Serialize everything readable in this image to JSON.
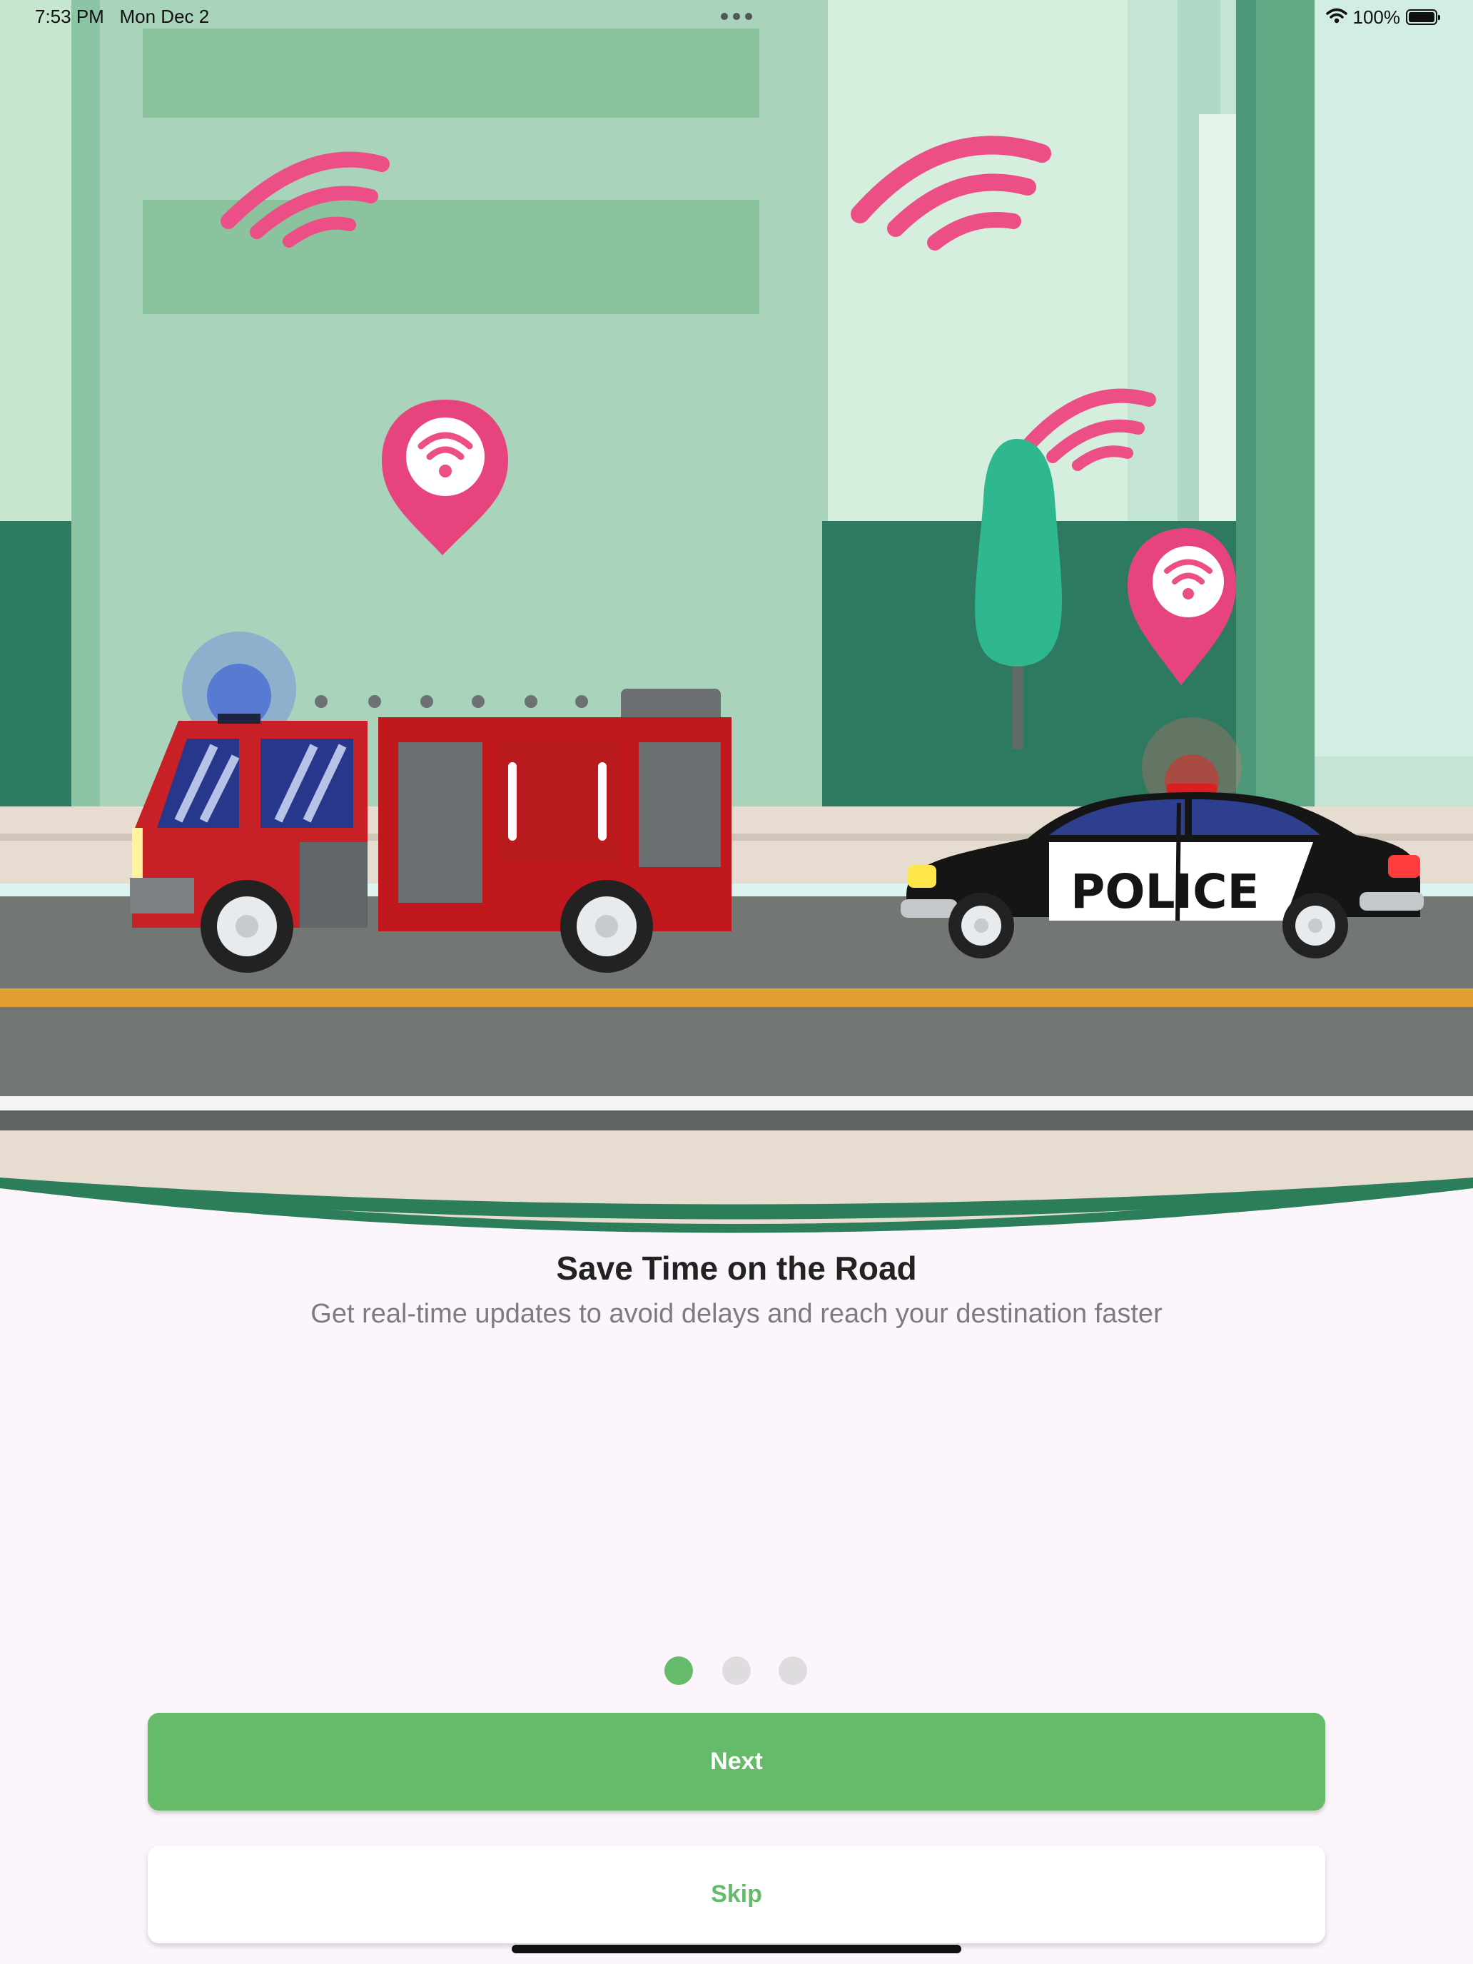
{
  "status_bar": {
    "time": "7:53 PM",
    "date": "Mon Dec 2",
    "battery": "100%",
    "icons": [
      "wifi-icon",
      "battery-icon"
    ]
  },
  "illustration": {
    "vehicle_label": "POLICE",
    "icons": [
      "wifi-signal-icon",
      "location-pin-icon"
    ]
  },
  "onboarding": {
    "title": "Save Time on the Road",
    "subtitle": "Get real-time updates to avoid delays and reach your destination faster",
    "page_count": 3,
    "current_page": 1
  },
  "buttons": {
    "next_label": "Next",
    "skip_label": "Skip"
  },
  "colors": {
    "accent": "#66bb6a",
    "background": "#fcf6fc",
    "signal_pink": "#ec4f86"
  }
}
